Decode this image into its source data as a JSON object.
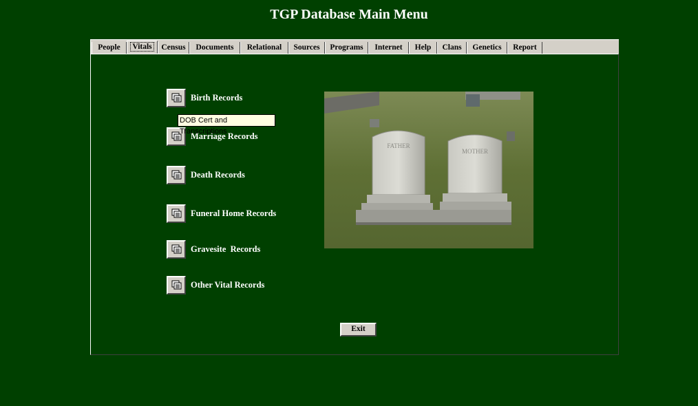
{
  "app": {
    "title": "TGP Database Main Menu"
  },
  "tabs": [
    {
      "label": "People"
    },
    {
      "label": "Vitals"
    },
    {
      "label": "Census"
    },
    {
      "label": "Documents"
    },
    {
      "label": "Relational"
    },
    {
      "label": "Sources"
    },
    {
      "label": "Programs"
    },
    {
      "label": "Internet"
    },
    {
      "label": "Help"
    },
    {
      "label": "Clans"
    },
    {
      "label": "Genetics"
    },
    {
      "label": "Report"
    }
  ],
  "active_tab": "Vitals",
  "menu": {
    "items": [
      {
        "label": "Birth Records",
        "icon": "records-icon"
      },
      {
        "label": "Marriage Records",
        "icon": "records-icon"
      },
      {
        "label": "Death Records",
        "icon": "records-icon"
      },
      {
        "label": "Funeral Home Records",
        "icon": "records-icon"
      },
      {
        "label": "Gravesite  Records",
        "icon": "records-icon"
      },
      {
        "label": "Other Vital Records",
        "icon": "records-icon"
      }
    ]
  },
  "tooltip": {
    "text": "DOB Cert and Transcriptions"
  },
  "photo": {
    "headstone_left_text": "FATHER",
    "headstone_right_text": "MOTHER"
  },
  "exit": {
    "label": "Exit"
  },
  "colors": {
    "background": "#004000",
    "chrome": "#d4d0c8",
    "text": "#ffffff"
  }
}
